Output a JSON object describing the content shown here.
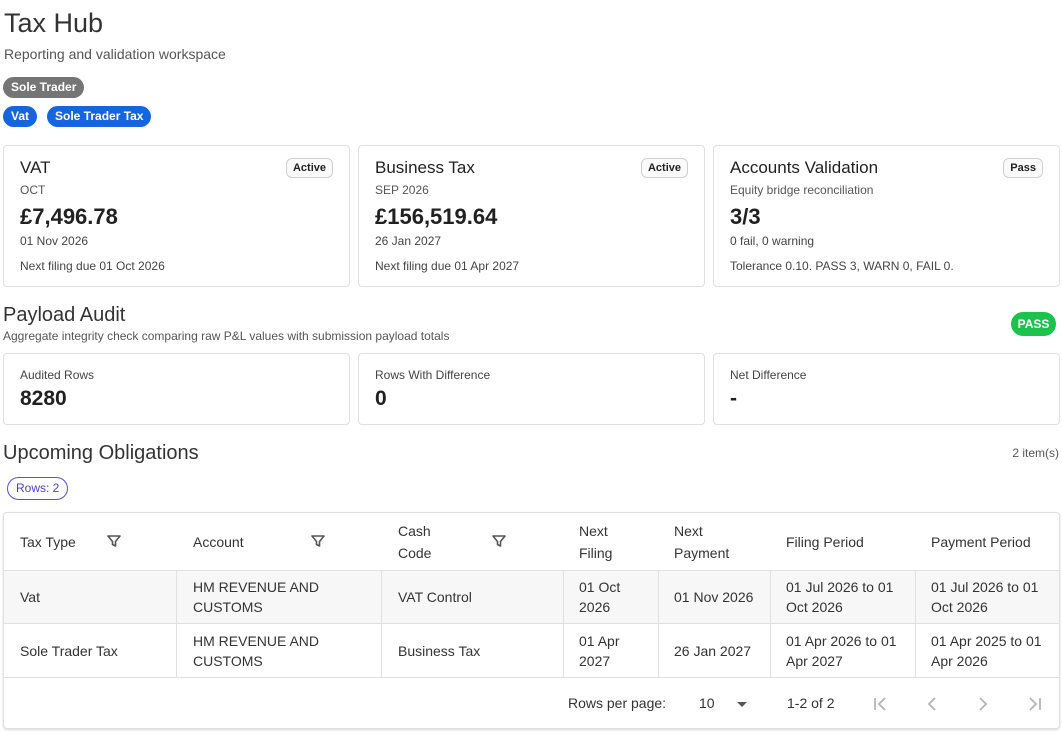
{
  "app": {
    "title": "Tax Hub",
    "subtitle": "Reporting and validation workspace"
  },
  "profile_chip": "Sole Trader",
  "tax_chips": [
    "Vat",
    "Sole Trader Tax"
  ],
  "summary_cards": [
    {
      "title": "VAT",
      "status": "Active",
      "period": "OCT",
      "value": "£7,496.78",
      "date": "01 Nov 2026",
      "foot": "Next filing due 01 Oct 2026"
    },
    {
      "title": "Business Tax",
      "status": "Active",
      "period": "SEP 2026",
      "value": "£156,519.64",
      "date": "26 Jan 2027",
      "foot": "Next filing due 01 Apr 2027"
    },
    {
      "title": "Accounts Validation",
      "status": "Pass",
      "period": "Equity bridge reconciliation",
      "value": "3/3",
      "date": "0 fail, 0 warning",
      "foot": "Tolerance 0.10. PASS 3, WARN 0, FAIL 0."
    }
  ],
  "payload_audit": {
    "title": "Payload Audit",
    "subtitle": "Aggregate integrity check comparing raw P&L values with submission payload totals",
    "badge": "PASS",
    "metrics": [
      {
        "label": "Audited Rows",
        "value": "8280"
      },
      {
        "label": "Rows With Difference",
        "value": "0"
      },
      {
        "label": "Net Difference",
        "value": "-"
      }
    ]
  },
  "obligations": {
    "title": "Upcoming Obligations",
    "item_count": "2 item(s)",
    "rows_chip": "Rows: 2",
    "columns": [
      "Tax Type",
      "Account",
      "Cash Code",
      "Next Filing",
      "Next Payment",
      "Filing Period",
      "Payment Period"
    ],
    "rows": [
      [
        "Vat",
        "HM REVENUE AND CUSTOMS",
        "VAT Control",
        "01 Oct 2026",
        "01 Nov 2026",
        "01 Jul 2026 to 01 Oct 2026",
        "01 Jul 2026 to 01 Oct 2026"
      ],
      [
        "Sole Trader Tax",
        "HM REVENUE AND CUSTOMS",
        "Business Tax",
        "01 Apr 2027",
        "26 Jan 2027",
        "01 Apr 2026 to 01 Apr 2027",
        "01 Apr 2025 to 01 Apr 2026"
      ]
    ],
    "pagination": {
      "rows_per_page_label": "Rows per page:",
      "rows_per_page_value": "10",
      "range": "1-2 of 2"
    }
  },
  "icons": {
    "filter": "filter-icon",
    "dropdown": "caret-down-icon",
    "first": "first-page-icon",
    "prev": "chevron-left-icon",
    "next": "chevron-right-icon",
    "last": "last-page-icon"
  },
  "colors": {
    "chip_grey": "#757575",
    "chip_blue": "#1565e0",
    "pass_green": "#1bc24b",
    "rows_chip_purple": "#5a4fcf"
  }
}
